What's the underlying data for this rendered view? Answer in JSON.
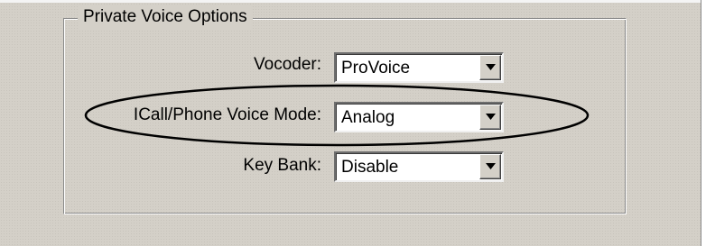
{
  "group": {
    "title": "Private Voice Options"
  },
  "fields": {
    "vocoder": {
      "label": "Vocoder:",
      "value": "ProVoice"
    },
    "icall_mode": {
      "label": "ICall/Phone Voice Mode:",
      "value": "Analog"
    },
    "key_bank": {
      "label": "Key Bank:",
      "value": "Disable"
    }
  },
  "icons": {
    "dropdown": "chevron-down-icon",
    "annotation": "highlight-ellipse"
  },
  "colors": {
    "panel": "#d4d0c8",
    "field_background": "#ffffff",
    "annotation_stroke": "#000000"
  }
}
